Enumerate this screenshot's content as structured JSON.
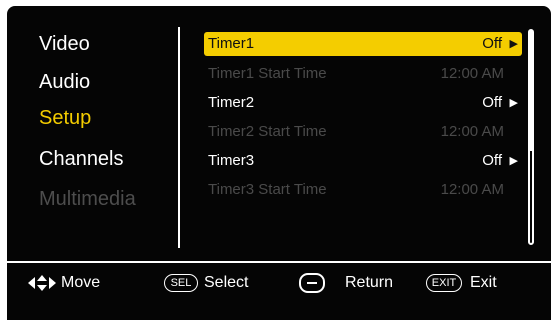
{
  "categories": [
    {
      "label": "Video",
      "state": "normal"
    },
    {
      "label": "Audio",
      "state": "normal"
    },
    {
      "label": "Setup",
      "state": "active"
    },
    {
      "label": "Channels",
      "state": "normal"
    },
    {
      "label": "Multimedia",
      "state": "disabled"
    }
  ],
  "settings": [
    {
      "label": "Timer1",
      "value": "Off",
      "state": "selected",
      "has_arrow": true
    },
    {
      "label": "Timer1 Start Time",
      "value": "12:00 AM",
      "state": "disabled",
      "has_arrow": false
    },
    {
      "label": "Timer2",
      "value": "Off",
      "state": "normal",
      "has_arrow": true
    },
    {
      "label": "Timer2 Start Time",
      "value": "12:00 AM",
      "state": "disabled",
      "has_arrow": false
    },
    {
      "label": "Timer3",
      "value": "Off",
      "state": "normal",
      "has_arrow": true
    },
    {
      "label": "Timer3 Start Time",
      "value": "12:00 AM",
      "state": "disabled",
      "has_arrow": false
    }
  ],
  "footer": {
    "move_label": "Move",
    "sel_badge": "SEL",
    "select_label": "Select",
    "return_label": "Return",
    "exit_badge": "EXIT",
    "exit_label": "Exit"
  },
  "colors": {
    "accent": "#f4cd00",
    "background": "#050505",
    "disabled": "#4a4a4a"
  }
}
